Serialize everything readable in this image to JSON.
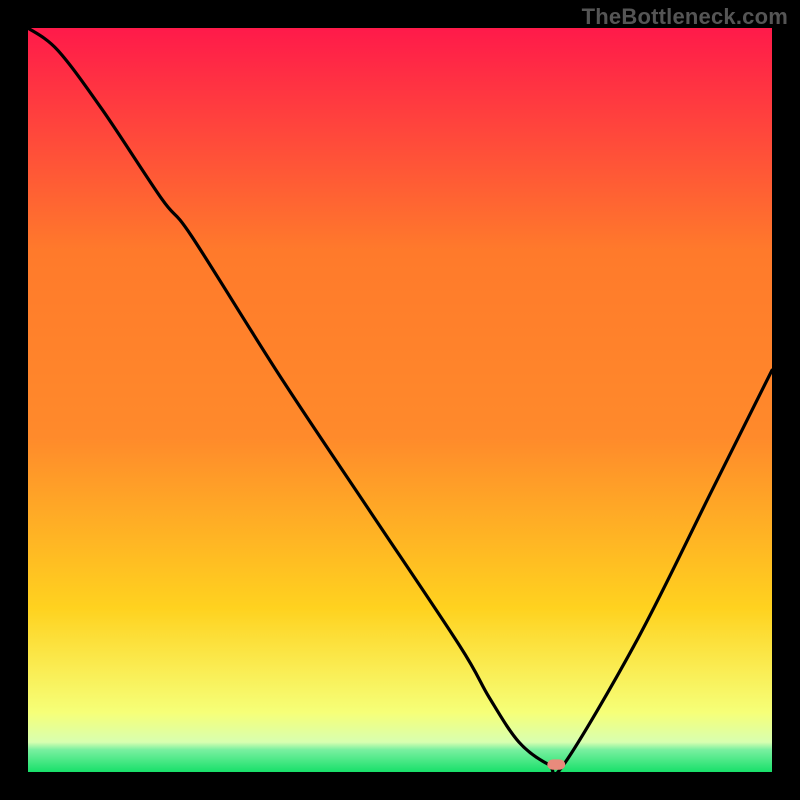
{
  "watermark": "TheBottleneck.com",
  "chart_data": {
    "type": "line",
    "title": "",
    "xlabel": "",
    "ylabel": "",
    "xlim": [
      0,
      100
    ],
    "ylim": [
      0,
      100
    ],
    "grid": false,
    "legend": false,
    "background_gradient": {
      "top_color": "#ff1a4a",
      "upper_mid_color": "#ff8a2b",
      "mid_color": "#ffd21f",
      "lower_mid_color": "#f6ff78",
      "green_band_color": "#18e06a",
      "green_band_y_range": [
        0,
        4
      ]
    },
    "series": [
      {
        "name": "bottleneck-curve",
        "color": "#000000",
        "x": [
          0,
          4,
          10,
          18,
          22,
          34,
          46,
          58,
          62,
          66,
          70,
          72,
          82,
          92,
          100
        ],
        "y": [
          100,
          97,
          89,
          77,
          72,
          53,
          35,
          17,
          10,
          4,
          1,
          1,
          18,
          38,
          54
        ]
      }
    ],
    "marker": {
      "name": "optimal-point",
      "shape": "rounded-rect",
      "color": "#e98a7c",
      "x": 71,
      "y": 1,
      "w_pct": 2.4,
      "h_pct": 1.4
    }
  }
}
